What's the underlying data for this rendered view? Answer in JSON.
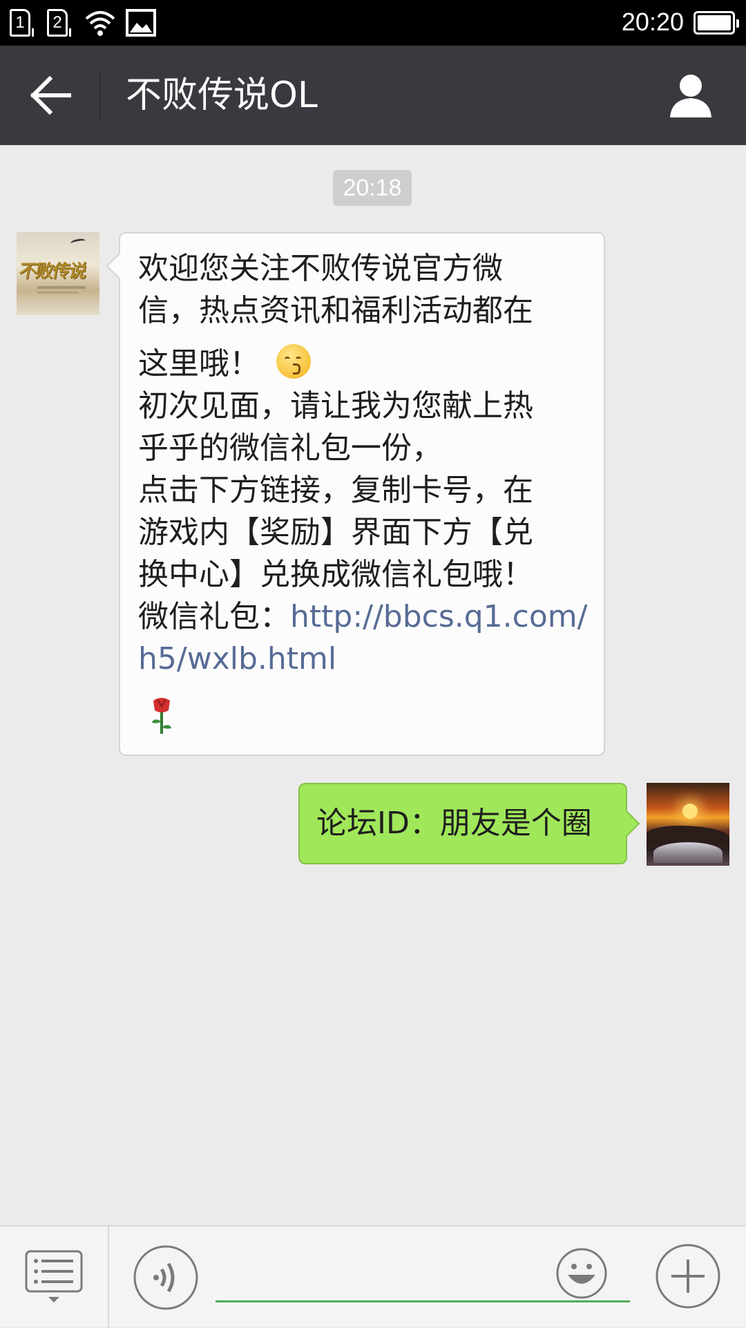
{
  "status_bar": {
    "sim1": "1",
    "sim2": "2",
    "time": "20:20",
    "icons": [
      "sim1-icon",
      "sim2-icon",
      "wifi-icon",
      "image-notification-icon",
      "battery-icon"
    ]
  },
  "header": {
    "title": "不败传说OL",
    "back_icon": "arrow-left-icon",
    "profile_icon": "person-icon"
  },
  "chat": {
    "timestamp": "20:18",
    "incoming": {
      "lines": [
        "欢迎您关注不败传说官方微",
        "信，热点资讯和福利活动都在",
        "这里哦！",
        "初次见面，请让我为您献上热",
        "乎乎的微信礼包一份，",
        "点击下方链接，复制卡号，在",
        "游戏内【奖励】界面下方【兑",
        "换中心】兑换成微信礼包哦！"
      ],
      "gift_label": "微信礼包：",
      "link_part1": "http://bbcs.q1.com/",
      "link_part2": "h5/wxlb.html",
      "emoji_kiss": "kissing-face-icon",
      "emoji_rose": "rose-icon"
    },
    "outgoing": {
      "text": "论坛ID：朋友是个圈"
    }
  },
  "input_bar": {
    "menu_icon": "menu-list-icon",
    "voice_icon": "voice-icon",
    "emoji_icon": "smiley-icon",
    "plus_icon": "plus-icon",
    "input_value": ""
  },
  "colors": {
    "header_bg": "#393a3f",
    "chat_bg": "#ebebeb",
    "outgoing_bubble": "#a0e75a",
    "link": "#576b95",
    "input_underline": "#4caf50"
  }
}
